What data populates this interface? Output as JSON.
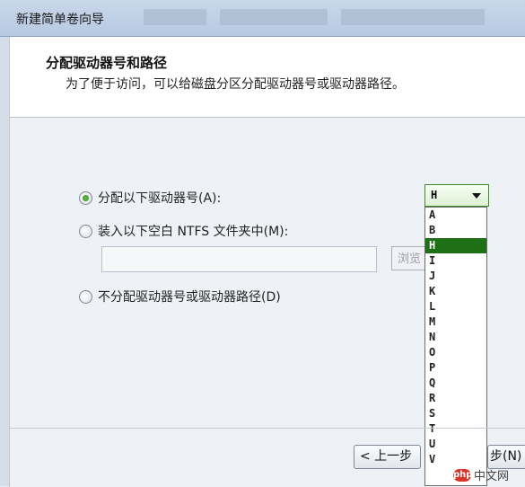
{
  "window": {
    "title": "新建简单卷向导"
  },
  "header": {
    "title": "分配驱动器号和路径",
    "subtitle": "为了便于访问，可以给磁盘分区分配驱动器号或驱动器路径。"
  },
  "options": [
    {
      "label": "分配以下驱动器号(A):",
      "checked": true
    },
    {
      "label": "装入以下空白 NTFS 文件夹中(M):",
      "checked": false
    },
    {
      "label": "不分配驱动器号或驱动器路径(D)",
      "checked": false
    }
  ],
  "folder_path": {
    "value": ""
  },
  "browse_button": {
    "label": "浏览"
  },
  "drive_select": {
    "value": "H",
    "options": [
      "A",
      "B",
      "H",
      "I",
      "J",
      "K",
      "L",
      "M",
      "N",
      "O",
      "P",
      "Q",
      "R",
      "S",
      "T",
      "U",
      "V"
    ],
    "selected": "H"
  },
  "nav": {
    "back_label": "< 上一步",
    "next_label": "步(N)"
  },
  "watermark": {
    "logo": "php",
    "text": "中文网"
  }
}
